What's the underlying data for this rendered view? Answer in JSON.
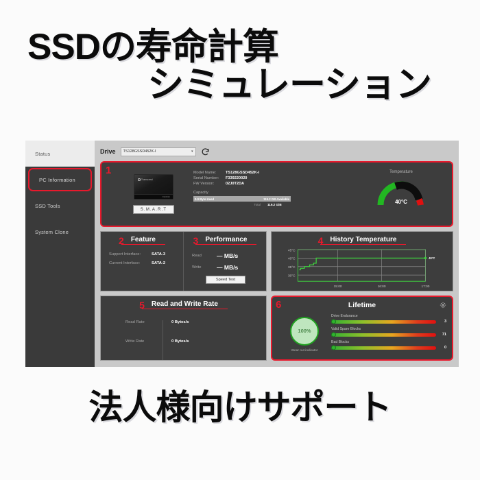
{
  "promo": {
    "line1": "SSDの寿命計算",
    "line2": "シミュレーション",
    "bottom": "法人様向けサポート"
  },
  "sidebar": {
    "items": [
      {
        "label": "Status",
        "state": "active-light"
      },
      {
        "label": "PC Information",
        "state": "outlined"
      },
      {
        "label": "SSD Tools",
        "state": "normal"
      },
      {
        "label": "System Clone",
        "state": "normal"
      }
    ]
  },
  "toolbar": {
    "drive_label": "Drive",
    "drive_value": "TS128GSSD452K-I",
    "caret": "▼",
    "refresh_icon": "refresh-icon"
  },
  "drive_panel": {
    "badge": "1",
    "brand": "Transcend",
    "ssd_side_text": "SSD452K",
    "smart_button": "S.M.A.R.T",
    "model_key": "Model Name:",
    "model_value": "TS128GSSD452K-I",
    "serial_key": "Serial Number:",
    "serial_value": "F339220020",
    "fw_key": "FW Version:",
    "fw_value": "02J0T2DA",
    "capacity_title": "Capacity",
    "used_text": "0.0 Byte Used",
    "available_text": "119.2 GB Available",
    "total_key": "Total",
    "total_value": "119.2 GiB",
    "temperature_title": "Temperature",
    "temperature_value": "40°C"
  },
  "feature": {
    "badge": "2",
    "title": "Feature",
    "support_key": "Support Interface:",
    "support_value": "SATA-3",
    "current_key": "Current Interface:",
    "current_value": "SATA-2"
  },
  "performance": {
    "badge": "3",
    "title": "Performance",
    "read_key": "Read",
    "read_value": "— MB/s",
    "write_key": "Write",
    "write_value": "— MB/s",
    "speed_test_button": "Speed Test"
  },
  "history": {
    "badge": "4",
    "title": "History Temperature",
    "point_label": "40°C"
  },
  "read_write": {
    "badge": "5",
    "title": "Read and Write Rate",
    "read_key": "Read Rate",
    "read_value": "0 Bytes/s",
    "write_key": "Write Rate",
    "write_value": "0 Bytes/s"
  },
  "lifetime": {
    "badge": "6",
    "title": "Lifetime",
    "gear_icon": "gear-icon",
    "wear_percent": "100%",
    "wear_label": "Wear out indicator",
    "bars": [
      {
        "name": "Drive Endurance",
        "value": "3"
      },
      {
        "name": "Valid Spare Blocks",
        "value": "71"
      },
      {
        "name": "Bad Blocks",
        "value": "0"
      }
    ]
  },
  "colors": {
    "accent_red": "#e8192c",
    "panel_bg": "#3d3d3d",
    "sidebar_bg": "#3a3a3a",
    "window_bg": "#c9c9c9",
    "green": "#2fb42f"
  },
  "chart_data": {
    "type": "line",
    "title": "History Temperature",
    "xlabel": "",
    "ylabel": "",
    "ylim": [
      28,
      46
    ],
    "yticks": [
      30,
      35,
      40,
      45
    ],
    "ytick_labels": [
      "30°C",
      "35°C",
      "40°C",
      "45°C"
    ],
    "xticks": [
      "15:00",
      "16:00",
      "17:00"
    ],
    "grid": true,
    "series": [
      {
        "name": "Temperature",
        "color": "#2fcd2f",
        "x": [
          0,
          2,
          4,
          6,
          8,
          10,
          12,
          14,
          16,
          100
        ],
        "values": [
          34,
          35,
          36,
          36,
          37,
          37,
          38,
          40,
          40,
          40
        ]
      }
    ],
    "annotations": [
      {
        "text": "40°C",
        "x": 100,
        "y": 40
      }
    ]
  }
}
